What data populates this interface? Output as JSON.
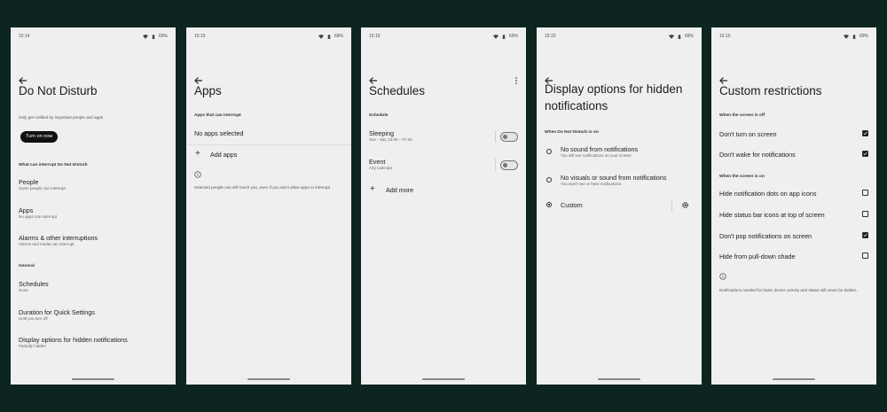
{
  "colors": {
    "background": "#0d2520",
    "screen": "#efefef",
    "button": "#111111"
  },
  "screens": [
    {
      "status": {
        "time": "15:14",
        "battery": "69%"
      },
      "title": "Do Not Disturb",
      "subtitle": "Only get notified by important people and apps",
      "turn_on_button": "Turn on now",
      "section_interrupt": "What can interrupt Do Not Disturb",
      "items": [
        {
          "title": "People",
          "subtitle": "Some people can interrupt"
        },
        {
          "title": "Apps",
          "subtitle": "No apps can interrupt"
        },
        {
          "title": "Alarms & other interruptions",
          "subtitle": "Alarms and media can interrupt"
        }
      ],
      "section_general": "General",
      "general_items": [
        {
          "title": "Schedules",
          "subtitle": "None"
        },
        {
          "title": "Duration for Quick Settings",
          "subtitle": "Until you turn off"
        },
        {
          "title": "Display options for hidden notifications",
          "subtitle": "Partially hidden"
        }
      ]
    },
    {
      "status": {
        "time": "15:15",
        "battery": "69%"
      },
      "title": "Apps",
      "section": "Apps that can interrupt",
      "no_apps": "No apps selected",
      "add_apps": "Add apps",
      "note": "Selected people can still reach you, even if you don't allow apps to interrupt"
    },
    {
      "status": {
        "time": "15:15",
        "battery": "69%"
      },
      "title": "Schedules",
      "section": "Schedule",
      "schedules": [
        {
          "title": "Sleeping",
          "subtitle": "Sun - Sat, 22:00 – 07:00"
        },
        {
          "title": "Event",
          "subtitle": "Any calendar"
        }
      ],
      "add_more": "Add more"
    },
    {
      "status": {
        "time": "15:15",
        "battery": "69%"
      },
      "title": "Display options for hidden notifications",
      "section": "When Do Not Disturb is on",
      "options": [
        {
          "title": "No sound from notifications",
          "subtitle": "You will see notifications on your screen",
          "selected": false
        },
        {
          "title": "No visuals or sound from notifications",
          "subtitle": "You won't see or hear notifications",
          "selected": false
        },
        {
          "title": "Custom",
          "subtitle": "",
          "selected": true
        }
      ]
    },
    {
      "status": {
        "time": "15:15",
        "battery": "69%"
      },
      "title": "Custom restrictions",
      "section_off": "When the screen is off",
      "off_items": [
        {
          "label": "Don't turn on screen",
          "checked": true
        },
        {
          "label": "Don't wake for notifications",
          "checked": true
        }
      ],
      "section_on": "When the screen is on",
      "on_items": [
        {
          "label": "Hide notification dots on app icons",
          "checked": false
        },
        {
          "label": "Hide status bar icons at top of screen",
          "checked": false
        },
        {
          "label": "Don't pop notifications on screen",
          "checked": true
        },
        {
          "label": "Hide from pull-down shade",
          "checked": false
        }
      ],
      "note": "Notifications needed for basic device activity and status will never be hidden."
    }
  ]
}
